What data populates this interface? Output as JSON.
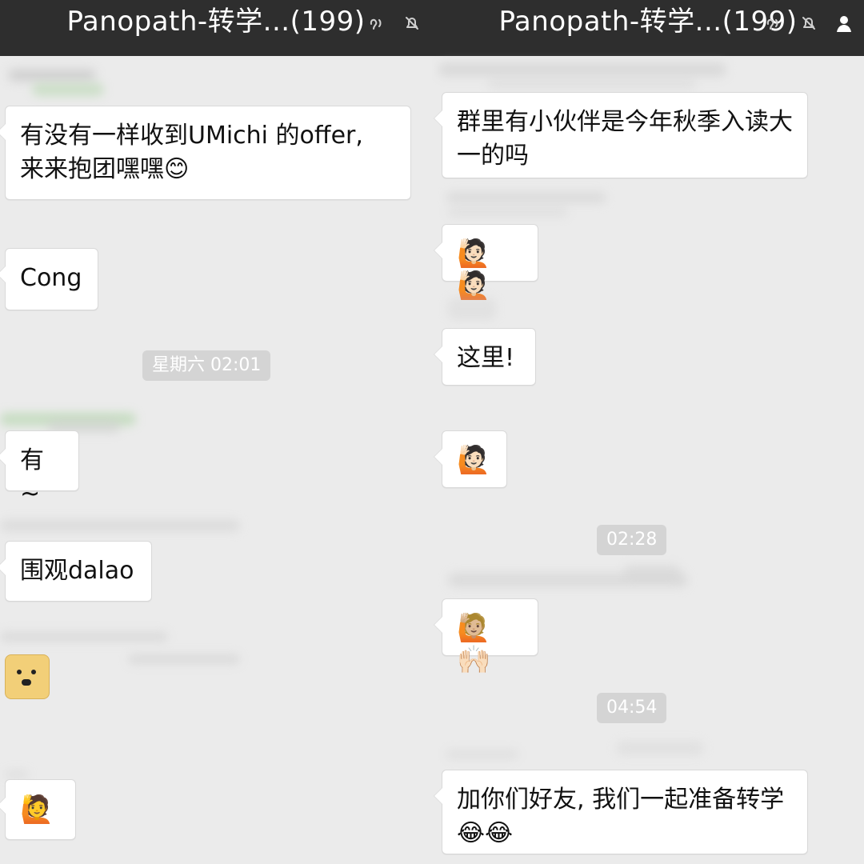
{
  "left": {
    "title": "Panopath-转学...(199)",
    "time_sep": "星期六 02:01",
    "messages": {
      "m1": "有没有一样收到UMichi 的offer,\n来来抱团嘿嘿😊",
      "m2": "Cong",
      "m3": "有~",
      "m4": "围观dalao",
      "m5": "🙋"
    }
  },
  "right": {
    "title": "Panopath-转学...(199)",
    "time_sep_1": "02:28",
    "time_sep_2": "04:54",
    "messages": {
      "r1": "群里有小伙伴是今年秋季入读大\n一的吗",
      "r2": "🙋🏻🙋🏻",
      "r3": "这里!",
      "r4": "🙋🏻",
      "r5": "🙋🏼🙌🏻",
      "r6": "加你们好友, 我们一起准备转学\n😂😂"
    }
  },
  "icons": {
    "status": [
      "listen-mode-icon",
      "mute-icon",
      "profile-icon"
    ]
  }
}
